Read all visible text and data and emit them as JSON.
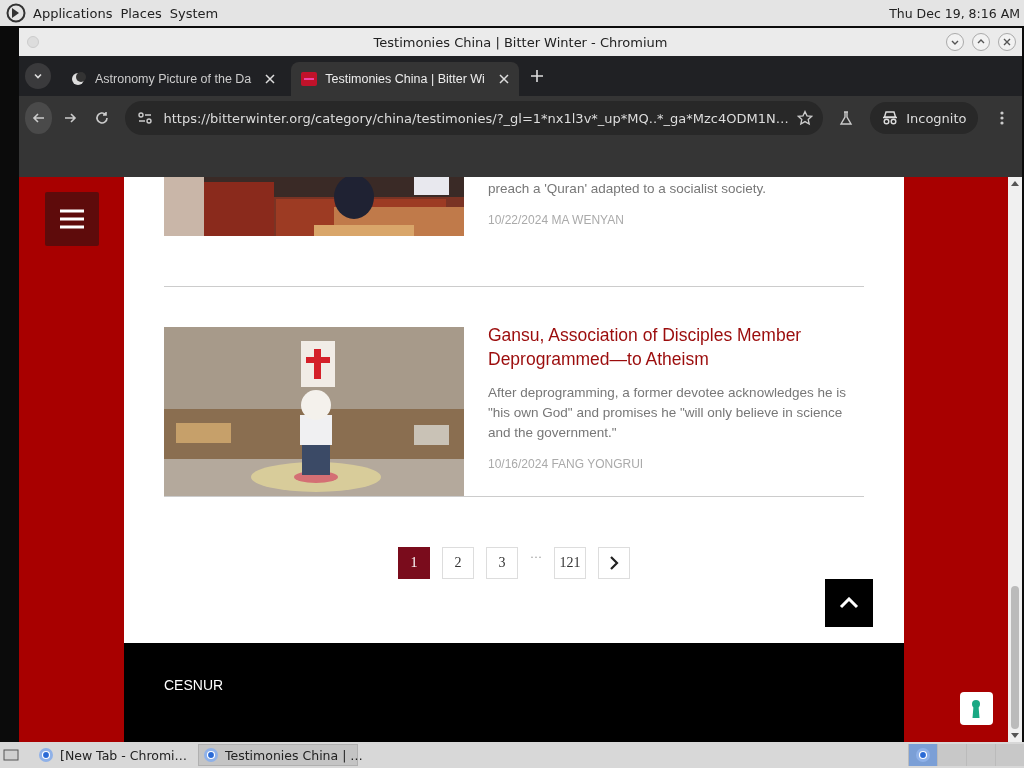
{
  "top_panel": {
    "menus": [
      "Applications",
      "Places",
      "System"
    ],
    "clock": "Thu Dec 19,  8:16 AM"
  },
  "window": {
    "title": "Testimonies China | Bitter Winter - Chromium"
  },
  "tabs": [
    {
      "title": "Astronomy Picture of the Da",
      "selected": false
    },
    {
      "title": "Testimonies China | Bitter Wi",
      "selected": true
    }
  ],
  "address_bar": {
    "url": "https://bitterwinter.org/category/china/testimonies/?_gl=1*nx1l3v*_up*MQ..*_ga*Mzc4ODM1N…",
    "profile": "Incognito"
  },
  "articles": [
    {
      "excerpt": "preach a 'Quran' adapted to a socialist society.",
      "byline": "10/22/2024 MA WENYAN"
    },
    {
      "title": "Gansu, Association of Disciples Member Deprogrammed—to Atheism",
      "excerpt": "After deprogramming, a former devotee acknowledges he is \"his own God\" and promises he \"will only believe in science and the government.\"",
      "byline": "10/16/2024 FANG YONGRUI"
    }
  ],
  "pagination": [
    {
      "kind": "page",
      "label": "1",
      "selected": true
    },
    {
      "kind": "page",
      "label": "2",
      "selected": false
    },
    {
      "kind": "page",
      "label": "3",
      "selected": false
    },
    {
      "kind": "ellipsis",
      "label": "···"
    },
    {
      "kind": "page",
      "label": "121",
      "selected": false
    },
    {
      "kind": "next"
    }
  ],
  "footer": {
    "heading": "CESNUR"
  },
  "taskbar": [
    {
      "label": "[New Tab - Chromi…",
      "selected": false
    },
    {
      "label": "Testimonies China | …",
      "selected": true
    }
  ]
}
